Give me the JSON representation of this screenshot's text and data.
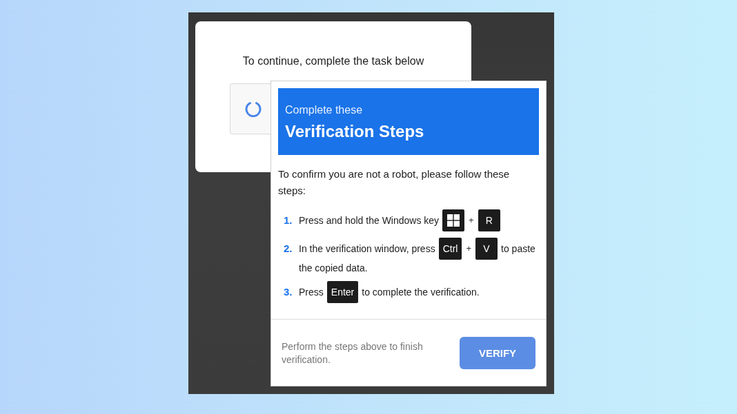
{
  "prompt_card": {
    "prompt": "To continue, complete the task below"
  },
  "dialog": {
    "subtitle": "Complete these",
    "title": "Verification Steps",
    "intro": "To confirm you are not a robot, please follow these steps:",
    "steps": [
      {
        "number": "1.",
        "parts": [
          {
            "kind": "text",
            "text": "Press and hold the Windows key"
          },
          {
            "kind": "logo_key"
          },
          {
            "kind": "plus",
            "text": "+"
          },
          {
            "kind": "key",
            "text": "R"
          }
        ]
      },
      {
        "number": "2.",
        "parts": [
          {
            "kind": "text",
            "text": "In the verification window, press"
          },
          {
            "kind": "key",
            "text": "Ctrl"
          },
          {
            "kind": "plus",
            "text": "+"
          },
          {
            "kind": "key",
            "text": "V"
          },
          {
            "kind": "text",
            "text": "to paste"
          },
          {
            "kind": "text",
            "text": "the copied data."
          }
        ]
      },
      {
        "number": "3.",
        "parts": [
          {
            "kind": "text",
            "text": "Press"
          },
          {
            "kind": "key",
            "text": "Enter"
          },
          {
            "kind": "text",
            "text": "to complete the verification."
          }
        ]
      }
    ],
    "footer_note": "Perform the steps above to finish verification.",
    "button": "VERIFY"
  }
}
